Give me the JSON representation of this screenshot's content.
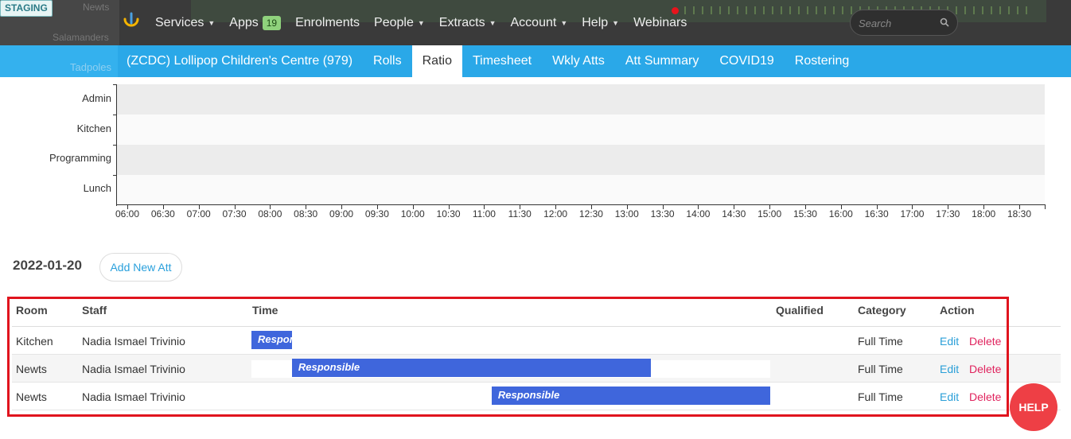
{
  "environment_badge": "STAGING",
  "nav": {
    "items": [
      {
        "label": "Services",
        "has_caret": true
      },
      {
        "label": "Apps",
        "badge": "19"
      },
      {
        "label": "Enrolments"
      },
      {
        "label": "People",
        "has_caret": true
      },
      {
        "label": "Extracts",
        "has_caret": true
      },
      {
        "label": "Account",
        "has_caret": true
      },
      {
        "label": "Help",
        "has_caret": true
      },
      {
        "label": "Webinars"
      }
    ],
    "search_placeholder": "Search"
  },
  "background_ghost": {
    "newts": "Newts",
    "salamanders": "Salamanders",
    "tadpoles": "Tadpoles"
  },
  "subnav": {
    "centre": "(ZCDC) Lollipop Children's Centre (979)",
    "tabs": [
      "Rolls",
      "Ratio",
      "Timesheet",
      "Wkly Atts",
      "Att Summary",
      "COVID19",
      "Rostering"
    ],
    "active_tab": "Ratio"
  },
  "chart_data": {
    "type": "timeline",
    "rows": [
      "Admin",
      "Kitchen",
      "Programming",
      "Lunch"
    ],
    "x_ticks": [
      "06:00",
      "06:30",
      "07:00",
      "07:30",
      "08:00",
      "08:30",
      "09:00",
      "09:30",
      "10:00",
      "10:30",
      "11:00",
      "11:30",
      "12:00",
      "12:30",
      "13:00",
      "13:30",
      "14:00",
      "14:30",
      "15:00",
      "15:30",
      "16:00",
      "16:30",
      "17:00",
      "17:30",
      "18:00",
      "18:30"
    ]
  },
  "date": "2022-01-20",
  "add_button": "Add New Att",
  "table": {
    "headers": {
      "room": "Room",
      "staff": "Staff",
      "time": "Time",
      "qualified": "Qualified",
      "category": "Category",
      "action": "Action"
    },
    "rows": [
      {
        "room": "Kitchen",
        "staff": "Nadia Ismael Trivinio",
        "bar_label": "Responsible",
        "bar_start": 0.0,
        "bar_end": 0.078,
        "qualified": "",
        "category": "Full Time",
        "edit": "Edit",
        "delete": "Delete"
      },
      {
        "room": "Newts",
        "staff": "Nadia Ismael Trivinio",
        "bar_label": "Responsible",
        "bar_start": 0.078,
        "bar_end": 0.77,
        "qualified": "",
        "category": "Full Time",
        "edit": "Edit",
        "delete": "Delete"
      },
      {
        "room": "Newts",
        "staff": "Nadia Ismael Trivinio",
        "bar_label": "Responsible",
        "bar_start": 0.463,
        "bar_end": 1.0,
        "qualified": "",
        "category": "Full Time",
        "edit": "Edit",
        "delete": "Delete"
      }
    ]
  },
  "help_button": "HELP",
  "colors": {
    "nav_dark": "#3a3a3a",
    "subnav_blue": "#2aa8e8",
    "bar_blue": "#3f66dc",
    "highlight_red": "#e0141e",
    "help_red": "#ee3f45"
  }
}
